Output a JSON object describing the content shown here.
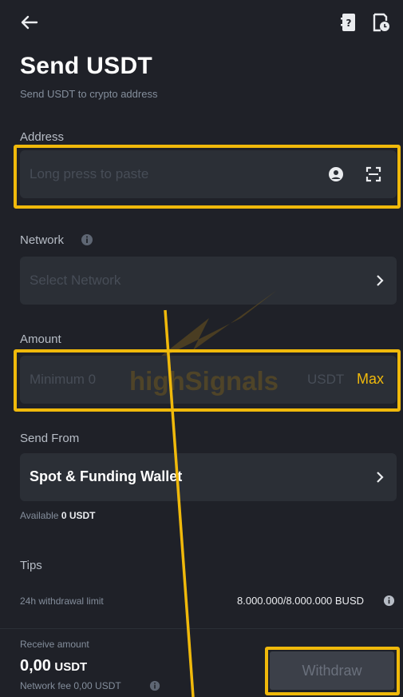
{
  "header": {
    "title": "Send USDT",
    "subtitle": "Send USDT to crypto address"
  },
  "address": {
    "label": "Address",
    "placeholder": "Long press to paste"
  },
  "network": {
    "label": "Network",
    "placeholder": "Select Network"
  },
  "amount": {
    "label": "Amount",
    "placeholder": "Minimum 0",
    "unit": "USDT",
    "max_label": "Max"
  },
  "send_from": {
    "label": "Send From",
    "wallet": "Spot & Funding Wallet",
    "available_label": "Available",
    "available_value": "0 USDT"
  },
  "tips": {
    "label": "Tips",
    "limit_label": "24h withdrawal limit",
    "limit_value": "8.000.000/8.000.000 BUSD"
  },
  "footer": {
    "receive_label": "Receive amount",
    "receive_value": "0,00",
    "receive_unit": "USDT",
    "fee_label": "Network fee 0,00 USDT",
    "withdraw_label": "Withdraw"
  },
  "watermark": "highSignals",
  "colors": {
    "accent": "#f0b90b",
    "background": "#1f2128",
    "field": "#2b2f36"
  },
  "icons": [
    "back-arrow-icon",
    "address-book-icon",
    "history-icon",
    "contact-icon",
    "scan-icon",
    "info-icon",
    "chevron-right-icon"
  ]
}
